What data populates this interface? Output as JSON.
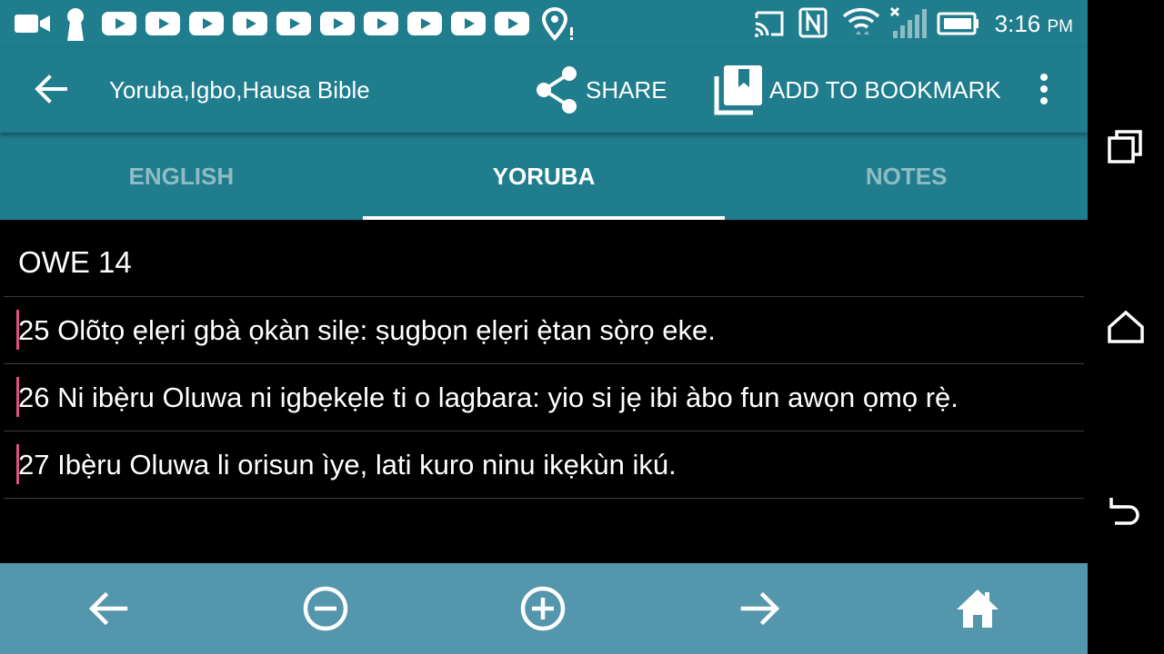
{
  "status_bar": {
    "time": "3:16",
    "ampm": "PM",
    "notification_icons": [
      "video-camera-icon",
      "keyhole-icon",
      "youtube-icon",
      "youtube-icon",
      "youtube-icon",
      "youtube-icon",
      "youtube-icon",
      "youtube-icon",
      "youtube-icon",
      "youtube-icon",
      "youtube-icon",
      "location-alert-icon"
    ],
    "system_icons": [
      "cast-icon",
      "nfc-icon",
      "wifi-icon",
      "cellular-off-icon",
      "battery-icon"
    ]
  },
  "toolbar": {
    "title": "Yoruba,Igbo,Hausa Bible",
    "share_label": "SHARE",
    "bookmark_label": "ADD TO BOOKMARK"
  },
  "tabs": [
    {
      "label": "ENGLISH",
      "active": false
    },
    {
      "label": "YORUBA",
      "active": true
    },
    {
      "label": "NOTES",
      "active": false
    }
  ],
  "content": {
    "chapter": "OWE 14",
    "verses": [
      "25 Olõtọ ẹlẹri gbà ọkàn silẹ: ṣugbọn ẹlẹri ẹ̀tan sọ̀rọ eke.",
      "26 Ni ibẹ̀ru Oluwa ni igbẹkẹle ti o lagbara: yio si jẹ ibi àbo fun awọn ọmọ rẹ̀.",
      "27 Ibẹ̀ru Oluwa li orisun ìye, lati kuro ninu ikẹkùn ikú."
    ]
  },
  "bottom_bar": {
    "buttons": [
      "previous-arrow-icon",
      "zoom-out-icon",
      "zoom-in-icon",
      "next-arrow-icon",
      "home-icon"
    ]
  },
  "colors": {
    "toolbar": "#1f7d8e",
    "bottom_bar": "#5496ab",
    "tab_inactive": "#8fbcc4",
    "verse_marker": "#e0507a"
  }
}
